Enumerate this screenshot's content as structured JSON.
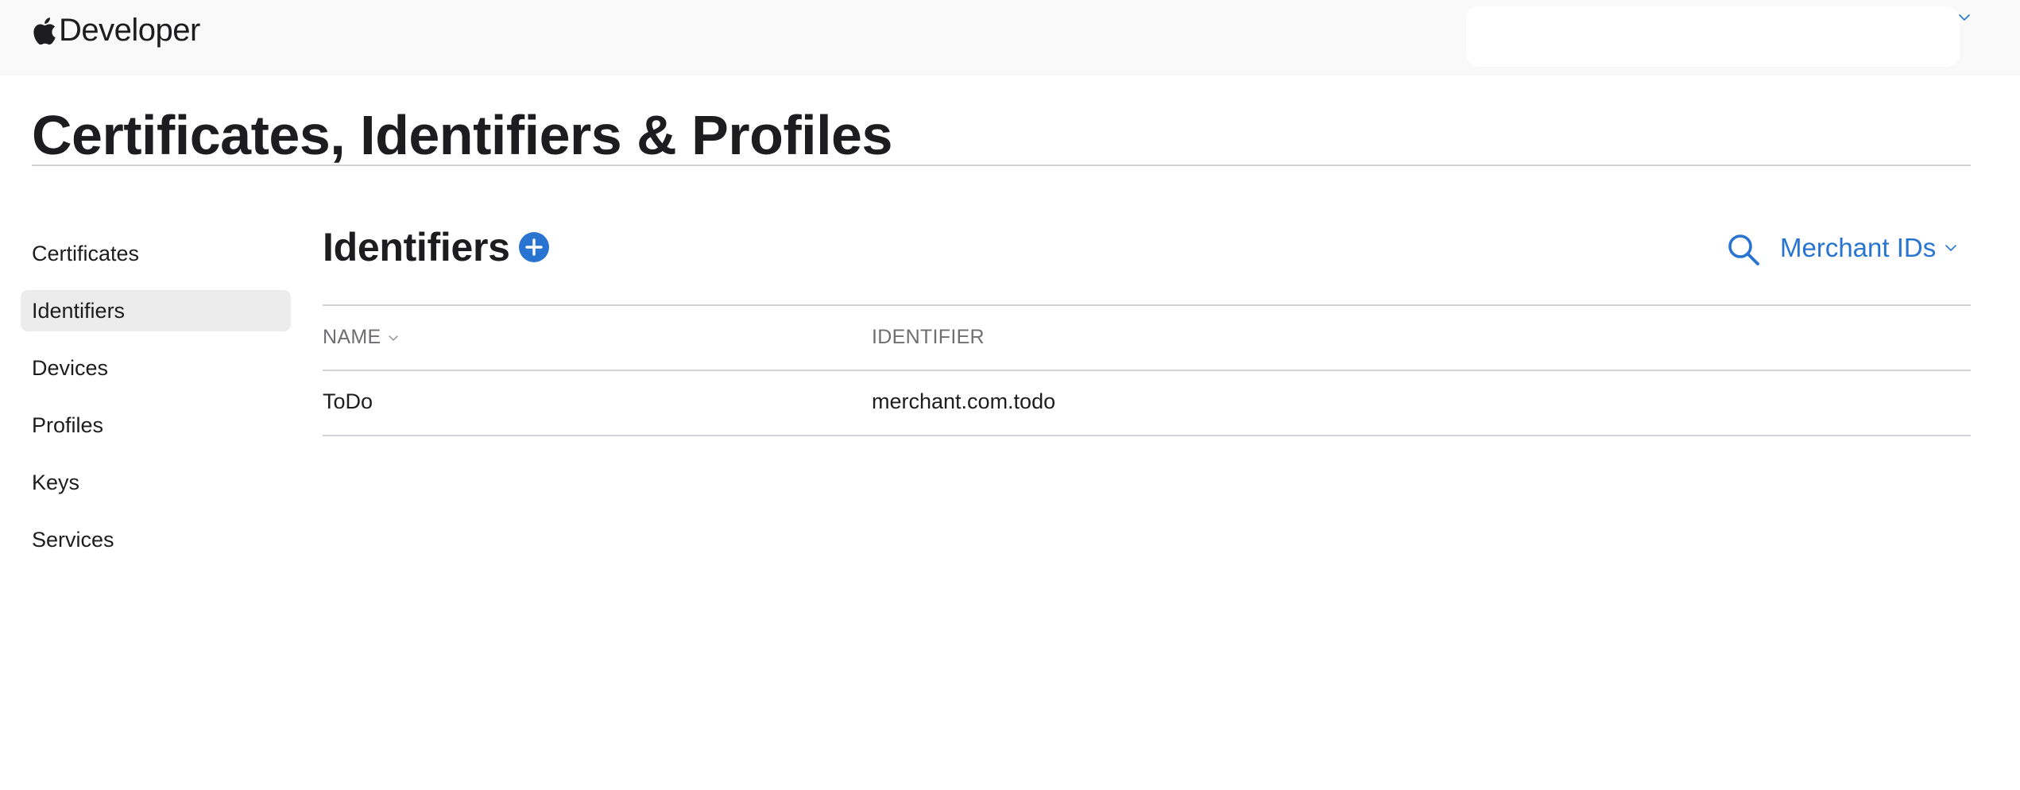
{
  "header": {
    "brand_text": "Developer",
    "brand_icon": "apple-logo-icon",
    "account_chevron_icon": "chevron-down-icon"
  },
  "page": {
    "title": "Certificates, Identifiers & Profiles"
  },
  "sidebar": {
    "items": [
      {
        "label": "Certificates",
        "active": false
      },
      {
        "label": "Identifiers",
        "active": true
      },
      {
        "label": "Devices",
        "active": false
      },
      {
        "label": "Profiles",
        "active": false
      },
      {
        "label": "Keys",
        "active": false
      },
      {
        "label": "Services",
        "active": false
      }
    ]
  },
  "main": {
    "section_title": "Identifiers",
    "add_icon": "plus-circle-icon",
    "search_icon": "search-icon",
    "filter_label": "Merchant IDs",
    "filter_icon": "chevron-down-icon",
    "table": {
      "columns": [
        "NAME",
        "IDENTIFIER"
      ],
      "sort_icon": "chevron-down-icon",
      "rows": [
        {
          "name": "ToDo",
          "identifier": "merchant.com.todo"
        }
      ]
    }
  },
  "colors": {
    "accent": "#2874d0",
    "topbar_bg": "#f9f9f9",
    "active_item_bg": "#ececec",
    "divider": "#d2d2d7",
    "muted_text": "#6e6e73"
  }
}
